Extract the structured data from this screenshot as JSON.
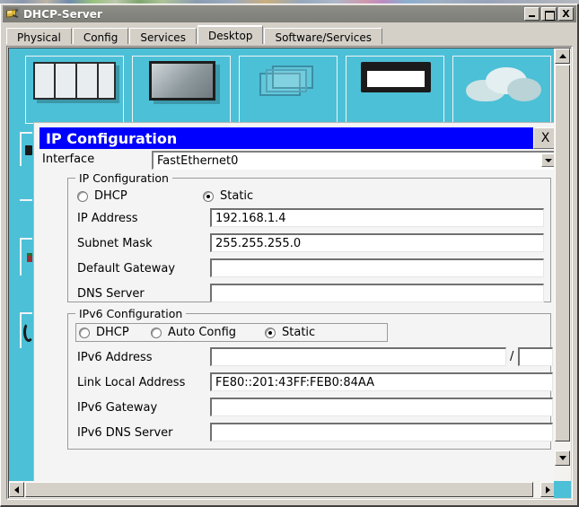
{
  "window": {
    "title": "DHCP-Server",
    "icon": "device-key-icon",
    "controls": {
      "minimize": "–",
      "maximize": "□",
      "close": "X"
    }
  },
  "tabs": [
    {
      "label": "Physical",
      "active": false
    },
    {
      "label": "Config",
      "active": false
    },
    {
      "label": "Services",
      "active": false
    },
    {
      "label": "Desktop",
      "active": true
    },
    {
      "label": "Software/Services",
      "active": false
    }
  ],
  "desktop": {
    "background_color": "#4cc0d7",
    "tiles": [
      {
        "name": "desktop-tile-1",
        "art": "windows-icon"
      },
      {
        "name": "desktop-tile-2",
        "art": "monitor-icon"
      },
      {
        "name": "desktop-tile-3",
        "art": "stacked-boxes-icon"
      },
      {
        "name": "desktop-tile-4",
        "art": "laptop-icon"
      },
      {
        "name": "desktop-tile-5",
        "art": "cloud-icon"
      }
    ]
  },
  "dialog": {
    "title": "IP Configuration",
    "title_bg": "#0000ff",
    "close_label": "X",
    "interface": {
      "label": "Interface",
      "value": "FastEthernet0",
      "dropdown_icon": "chevron-down-icon"
    },
    "ipv4": {
      "group_title": "IP Configuration",
      "modes": [
        {
          "label": "DHCP",
          "selected": false
        },
        {
          "label": "Static",
          "selected": true
        }
      ],
      "fields": [
        {
          "label": "IP Address",
          "value": "192.168.1.4"
        },
        {
          "label": "Subnet Mask",
          "value": "255.255.255.0"
        },
        {
          "label": "Default Gateway",
          "value": ""
        },
        {
          "label": "DNS Server",
          "value": ""
        }
      ]
    },
    "ipv6": {
      "group_title": "IPv6 Configuration",
      "modes": [
        {
          "label": "DHCP",
          "selected": false
        },
        {
          "label": "Auto Config",
          "selected": false
        },
        {
          "label": "Static",
          "selected": true
        }
      ],
      "address": {
        "label": "IPv6 Address",
        "value": "",
        "separator": "/",
        "prefix_value": ""
      },
      "fields": [
        {
          "label": "Link Local Address",
          "value": "FE80::201:43FF:FEB0:84AA"
        },
        {
          "label": "IPv6 Gateway",
          "value": ""
        },
        {
          "label": "IPv6 DNS Server",
          "value": ""
        }
      ]
    }
  },
  "scrollbars": {
    "vertical": {
      "up_icon": "triangle-up-icon",
      "down_icon": "triangle-down-icon"
    },
    "horizontal": {
      "left_icon": "triangle-left-icon",
      "right_icon": "triangle-right-icon"
    }
  }
}
